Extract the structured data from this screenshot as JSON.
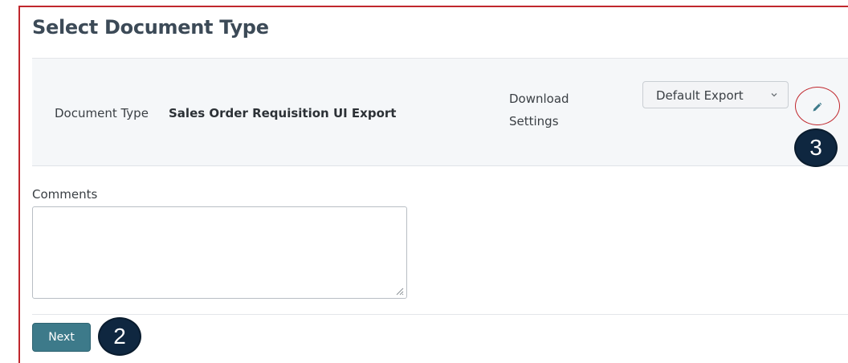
{
  "page": {
    "title": "Select Document Type"
  },
  "document": {
    "type_label": "Document Type",
    "type_value": "Sales Order Requisition UI Export",
    "download_settings_label": "Download Settings",
    "download_select": {
      "selected": "Default Export",
      "icon": "chevron-down-icon"
    },
    "edit_icon": "pencil-icon"
  },
  "comments": {
    "label": "Comments",
    "value": "",
    "placeholder": ""
  },
  "actions": {
    "next_label": "Next"
  },
  "callouts": {
    "edit_step": "3",
    "next_step": "2"
  },
  "colors": {
    "accent": "#3d7a8a",
    "highlight": "#c0272d",
    "badge": "#0f2740"
  }
}
